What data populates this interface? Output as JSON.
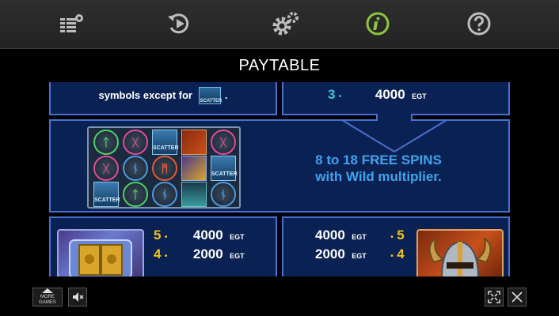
{
  "title": "PAYTABLE",
  "nav": {
    "icons": [
      "menu-settings-icon",
      "autoplay-icon",
      "settings-gears-icon",
      "info-icon",
      "help-icon"
    ],
    "active_color": "#8cc63f",
    "inactive_color": "#bdbdbd"
  },
  "wild_panel": {
    "text": "symbols except for",
    "scatter_label": "SCATTER",
    "end": "."
  },
  "scatter_pay": {
    "count": "3",
    "dot": "•",
    "amount": "4000",
    "currency": "EGT"
  },
  "free_spins": {
    "line1": "8 to 18 FREE SPINS",
    "line2": "with Wild multiplier."
  },
  "pay_left": [
    {
      "count": "5",
      "dot": "•",
      "amount": "4000",
      "currency": "EGT"
    },
    {
      "count": "4",
      "dot": "•",
      "amount": "2000",
      "currency": "EGT"
    }
  ],
  "pay_right": [
    {
      "count": "5",
      "dot": "•",
      "amount": "4000",
      "currency": "EGT"
    },
    {
      "count": "4",
      "dot": "•",
      "amount": "2000",
      "currency": "EGT"
    }
  ],
  "grid_cells": [
    "rune-t",
    "rune-x",
    "scatter",
    "viking-helmet",
    "rune-x",
    "rune-x",
    "rune-n",
    "rune-m",
    "wild-chest",
    "scatter",
    "scatter",
    "rune-t",
    "rune-n",
    "lightning",
    "rune-n"
  ],
  "grid_scatter_label": "SCATTER",
  "bottom": {
    "more_games": "MORE GAMES"
  },
  "colors": {
    "panel": "#0a2153",
    "panel_border": "#4a6fd0",
    "cyan": "#35c7d8",
    "gold": "#f2c318",
    "blue_text": "#3fa4ef"
  }
}
